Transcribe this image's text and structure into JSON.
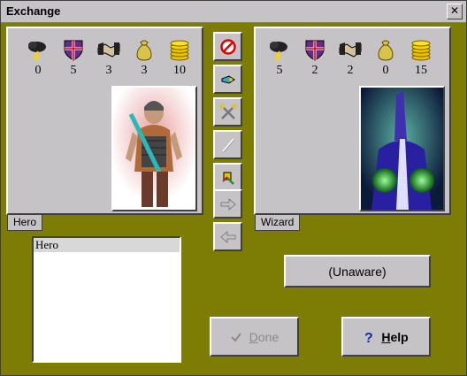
{
  "window": {
    "title": "Exchange",
    "close_glyph": "✕"
  },
  "hero": {
    "tab_label": "Hero",
    "stats": [
      {
        "icon": "storm-cloud-icon",
        "value": "0"
      },
      {
        "icon": "shield-icon",
        "value": "5"
      },
      {
        "icon": "handshake-icon",
        "value": "3"
      },
      {
        "icon": "money-bag-icon",
        "value": "3"
      },
      {
        "icon": "gold-coins-icon",
        "value": "10"
      }
    ]
  },
  "wizard": {
    "tab_label": "Wizard",
    "stats": [
      {
        "icon": "storm-cloud-icon",
        "value": "5"
      },
      {
        "icon": "shield-icon",
        "value": "2"
      },
      {
        "icon": "handshake-icon",
        "value": "2"
      },
      {
        "icon": "money-bag-icon",
        "value": "0"
      },
      {
        "icon": "gold-coins-icon",
        "value": "15"
      }
    ]
  },
  "list": {
    "items": [
      "Hero"
    ]
  },
  "status_button": {
    "label": "(Unaware)"
  },
  "done_button": {
    "label_first": "D",
    "label_rest": "one",
    "icon": "checkmark-icon"
  },
  "help_button": {
    "label_first": "H",
    "label_rest": "elp",
    "icon": "question-icon"
  },
  "middle_buttons": [
    "no-icon",
    "offer-icon",
    "swords-icon",
    "slash-icon",
    "give-icon",
    "arrow-right-icon",
    "arrow-left-icon"
  ]
}
